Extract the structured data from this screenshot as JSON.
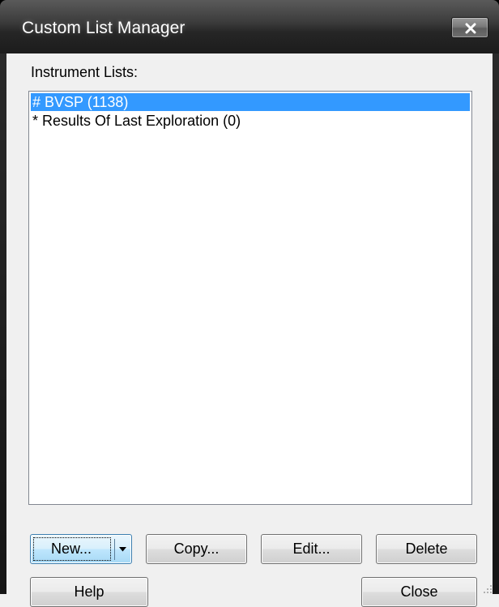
{
  "window": {
    "title": "Custom List Manager",
    "close_glyph": "✕"
  },
  "lists": {
    "label": "Instrument Lists:",
    "items": [
      {
        "text": "# BVSP (1138)",
        "selected": true
      },
      {
        "text": "* Results Of Last Exploration (0)",
        "selected": false
      }
    ]
  },
  "buttons": {
    "new": "New...",
    "copy": "Copy...",
    "edit": "Edit...",
    "delete": "Delete",
    "help": "Help",
    "close": "Close"
  },
  "icons": {
    "close": "close-icon",
    "dropdown": "dropdown-arrow-icon",
    "grip": "resize-grip-icon"
  },
  "colors": {
    "selection": "#3399ff",
    "titlebar": "#262626",
    "dialog_bg": "#f0f0f0"
  }
}
